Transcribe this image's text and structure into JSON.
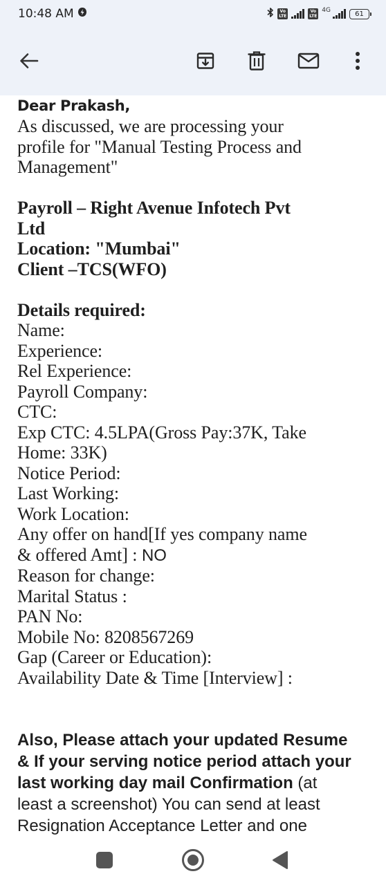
{
  "status_bar": {
    "time": "10:48 AM",
    "network": "4G",
    "battery": "61"
  },
  "toolbar": {
    "back_icon": "arrow-left-icon",
    "archive_icon": "archive-icon",
    "delete_icon": "trash-icon",
    "mark_unread_icon": "envelope-icon",
    "more_icon": "more-vertical-icon"
  },
  "email": {
    "greeting": "Dear Prakash,",
    "intro_lines": [
      "As discussed, we are processing your",
      "profile for \"Manual Testing Process and",
      "Management\""
    ],
    "job_info_lines": [
      "Payroll – Right Avenue Infotech Pvt",
      "Ltd",
      "Location: \"Mumbai\"",
      "Client –TCS(WFO)"
    ],
    "details_heading": "Details required:",
    "details_lines": [
      "Name:",
      "Experience:",
      "Rel Experience:",
      "Payroll Company:",
      "CTC:",
      "Exp CTC: 4.5LPA(Gross Pay:37K, Take",
      "Home: 33K)",
      "Notice Period:",
      "Last Working:",
      "Work Location:",
      "Any offer on hand[If yes company name"
    ],
    "offer_line_prefix": "& offered Amt] :",
    "offer_line_value": " NO",
    "details_lines_2": [
      "Reason for change:",
      "Marital Status :",
      "PAN No:",
      "Mobile No: 8208567269",
      "Gap (Career or Education):",
      "Availability Date & Time [Interview] :"
    ],
    "closing_bold_1": "Also, Please attach your updated Resume",
    "closing_bold_2": "& If your serving notice period attach your",
    "closing_bold_3": "last working day mail Confirmation",
    "closing_normal_3": " (at",
    "closing_line_4": "least a screenshot) You can send at least",
    "closing_line_5": "Resignation Acceptance Letter and one"
  },
  "nav_bar": {
    "recents_icon": "square-icon",
    "home_icon": "circle-home-icon",
    "back_icon": "triangle-back-icon"
  }
}
